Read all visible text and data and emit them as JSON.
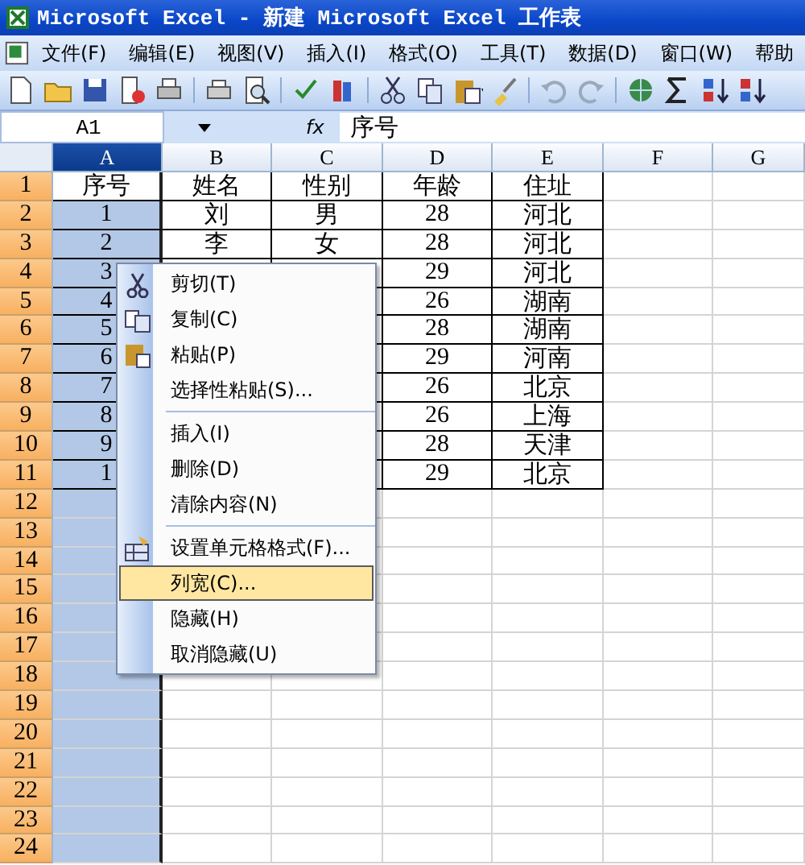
{
  "window": {
    "title": "Microsoft Excel - 新建 Microsoft Excel 工作表"
  },
  "menu_bar": [
    "文件(F)",
    "编辑(E)",
    "视图(V)",
    "插入(I)",
    "格式(O)",
    "工具(T)",
    "数据(D)",
    "窗口(W)",
    "帮助"
  ],
  "formula_bar": {
    "name_box": "A1",
    "fx": "fx",
    "formula": "序号"
  },
  "columns": [
    {
      "label": "A",
      "selected": true
    },
    {
      "label": "B",
      "selected": false
    },
    {
      "label": "C",
      "selected": false
    },
    {
      "label": "D",
      "selected": false
    },
    {
      "label": "E",
      "selected": false
    },
    {
      "label": "F",
      "selected": false
    },
    {
      "label": "G",
      "selected": false
    }
  ],
  "rows": [
    {
      "header": "1",
      "active": true,
      "cells": [
        "序号",
        "姓名",
        "性别",
        "年龄",
        "住址"
      ]
    },
    {
      "header": "2",
      "active": false,
      "cells": [
        "1",
        "刘",
        "男",
        "28",
        "河北"
      ]
    },
    {
      "header": "3",
      "active": false,
      "cells": [
        "2",
        "李",
        "女",
        "28",
        "河北"
      ]
    },
    {
      "header": "4",
      "active": false,
      "cells": [
        "3",
        null,
        null,
        "29",
        "河北"
      ]
    },
    {
      "header": "5",
      "active": false,
      "cells": [
        "4",
        null,
        null,
        "26",
        "湖南"
      ]
    },
    {
      "header": "6",
      "active": false,
      "cells": [
        "5",
        null,
        null,
        "28",
        "湖南"
      ]
    },
    {
      "header": "7",
      "active": false,
      "cells": [
        "6",
        null,
        null,
        "29",
        "河南"
      ]
    },
    {
      "header": "8",
      "active": false,
      "cells": [
        "7",
        null,
        null,
        "26",
        "北京"
      ]
    },
    {
      "header": "9",
      "active": false,
      "cells": [
        "8",
        null,
        null,
        "26",
        "上海"
      ]
    },
    {
      "header": "10",
      "active": false,
      "cells": [
        "9",
        null,
        null,
        "28",
        "天津"
      ]
    },
    {
      "header": "11",
      "active": false,
      "cells": [
        "1",
        null,
        null,
        "29",
        "北京"
      ]
    },
    {
      "header": "12",
      "active": false,
      "cells": []
    },
    {
      "header": "13",
      "active": false,
      "cells": []
    },
    {
      "header": "14",
      "active": false,
      "cells": []
    },
    {
      "header": "15",
      "active": false,
      "cells": []
    },
    {
      "header": "16",
      "active": false,
      "cells": []
    },
    {
      "header": "17",
      "active": false,
      "cells": []
    },
    {
      "header": "18",
      "active": false,
      "cells": []
    },
    {
      "header": "19",
      "active": false,
      "cells": []
    },
    {
      "header": "20",
      "active": false,
      "cells": []
    },
    {
      "header": "21",
      "active": false,
      "cells": []
    },
    {
      "header": "22",
      "active": false,
      "cells": []
    },
    {
      "header": "23",
      "active": false,
      "cells": []
    },
    {
      "header": "24",
      "active": false,
      "cells": []
    }
  ],
  "context_menu": [
    {
      "kind": "item",
      "label": "剪切(T)",
      "selected": false
    },
    {
      "kind": "item",
      "label": "复制(C)",
      "selected": false
    },
    {
      "kind": "item",
      "label": "粘贴(P)",
      "selected": false
    },
    {
      "kind": "item",
      "label": "选择性粘贴(S)...",
      "selected": false
    },
    {
      "kind": "separator"
    },
    {
      "kind": "item",
      "label": "插入(I)",
      "selected": false
    },
    {
      "kind": "item",
      "label": "删除(D)",
      "selected": false
    },
    {
      "kind": "item",
      "label": "清除内容(N)",
      "selected": false
    },
    {
      "kind": "separator"
    },
    {
      "kind": "item",
      "label": "设置单元格格式(F)...",
      "selected": false
    },
    {
      "kind": "item",
      "label": "列宽(C)...",
      "selected": true
    },
    {
      "kind": "item",
      "label": "隐藏(H)",
      "selected": false
    },
    {
      "kind": "item",
      "label": "取消隐藏(U)",
      "selected": false
    }
  ]
}
